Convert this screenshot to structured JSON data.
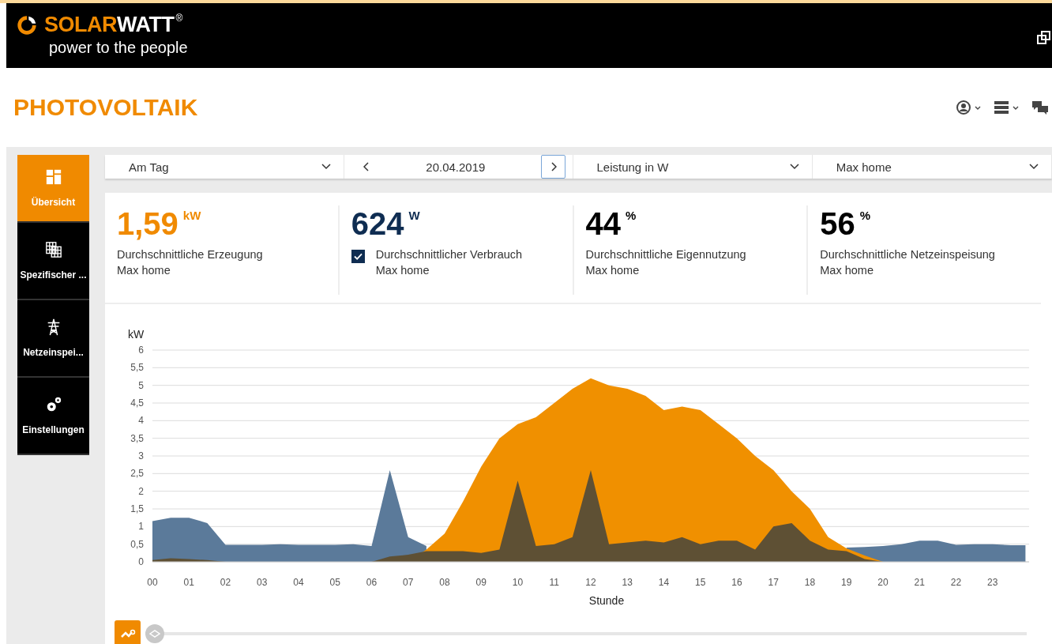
{
  "header": {
    "brand_first": "SOLAR",
    "brand_second": "WATT",
    "registered": "®",
    "tagline": "power to the people"
  },
  "page_title": "PHOTOVOLTAIK",
  "sidebar": {
    "items": [
      {
        "label": "Übersicht",
        "selected": true
      },
      {
        "label": "Spezifischer ...",
        "selected": false
      },
      {
        "label": "Netzeinspei...",
        "selected": false
      },
      {
        "label": "Einstellungen",
        "selected": false
      }
    ]
  },
  "filters": {
    "period": "Am Tag",
    "date": "20.04.2019",
    "unit": "Leistung in W",
    "system": "Max home"
  },
  "stats": [
    {
      "value": "1,59",
      "unit": "kW",
      "label": "Durchschnittliche Erzeugung",
      "sub": "Max home",
      "color": "#f08a00"
    },
    {
      "value": "624",
      "unit": "W",
      "label": "Durchschnittlicher Verbrauch",
      "sub": "Max home",
      "color": "#0f2d52",
      "checked": true
    },
    {
      "value": "44",
      "unit": "%",
      "label": "Durchschnittliche Eigennutzung",
      "sub": "Max home",
      "color": "#000000"
    },
    {
      "value": "56",
      "unit": "%",
      "label": "Durchschnittliche Netzeinspeisung",
      "sub": "Max home",
      "color": "#000000"
    }
  ],
  "chart": {
    "chart_data": {
      "type": "area",
      "grid": true,
      "ylabel": "kW",
      "xlabel": "Stunde",
      "xlim": [
        0,
        24
      ],
      "ylim": [
        0,
        6
      ],
      "x": [
        0,
        0.5,
        1,
        1.5,
        2,
        2.5,
        3,
        3.5,
        4,
        4.5,
        5,
        5.5,
        6,
        6.5,
        7,
        7.5,
        8,
        8.5,
        9,
        9.5,
        10,
        10.5,
        11,
        11.5,
        12,
        12.5,
        13,
        13.5,
        14,
        14.5,
        15,
        15.5,
        16,
        16.5,
        17,
        17.5,
        18,
        18.5,
        19,
        19.5,
        20,
        20.5,
        21,
        21.5,
        22,
        22.5,
        23,
        23.5,
        23.9
      ],
      "xticks": [
        {
          "value": 0,
          "label": "00"
        },
        {
          "value": 1,
          "label": "01"
        },
        {
          "value": 2,
          "label": "02"
        },
        {
          "value": 3,
          "label": "03"
        },
        {
          "value": 4,
          "label": "04"
        },
        {
          "value": 5,
          "label": "05"
        },
        {
          "value": 6,
          "label": "06"
        },
        {
          "value": 7,
          "label": "07"
        },
        {
          "value": 8,
          "label": "08"
        },
        {
          "value": 9,
          "label": "09"
        },
        {
          "value": 10,
          "label": "10"
        },
        {
          "value": 11,
          "label": "11"
        },
        {
          "value": 12,
          "label": "12"
        },
        {
          "value": 13,
          "label": "13"
        },
        {
          "value": 14,
          "label": "14"
        },
        {
          "value": 15,
          "label": "15"
        },
        {
          "value": 16,
          "label": "16"
        },
        {
          "value": 17,
          "label": "17"
        },
        {
          "value": 18,
          "label": "18"
        },
        {
          "value": 19,
          "label": "19"
        },
        {
          "value": 20,
          "label": "20"
        },
        {
          "value": 21,
          "label": "21"
        },
        {
          "value": 22,
          "label": "22"
        },
        {
          "value": 23,
          "label": "23"
        }
      ],
      "yticks": [
        0,
        {
          "value": 0.5,
          "label": "0,5"
        },
        1,
        {
          "value": 1.5,
          "label": "1,5"
        },
        2,
        {
          "value": 2.5,
          "label": "2,5"
        },
        3,
        {
          "value": 3.5,
          "label": "3,5"
        },
        4,
        {
          "value": 4.5,
          "label": "4,5"
        },
        5,
        {
          "value": 5.5,
          "label": "5,5"
        },
        6
      ],
      "series": [
        {
          "color": "#5b7a9a",
          "values": [
            1.15,
            1.25,
            1.25,
            1.1,
            0.48,
            0.48,
            0.48,
            0.5,
            0.48,
            0.48,
            0.48,
            0.5,
            0.45,
            2.6,
            0.7,
            0.45,
            null,
            null,
            null,
            null,
            null,
            null,
            null,
            null,
            null,
            null,
            null,
            null,
            null,
            null,
            null,
            null,
            null,
            null,
            null,
            null,
            null,
            null,
            0.4,
            0.42,
            0.45,
            0.5,
            0.6,
            0.6,
            0.48,
            0.5,
            0.5,
            0.47,
            0.47
          ]
        },
        {
          "color": "#f09000",
          "values": [
            0,
            0,
            0,
            0,
            0,
            0,
            0,
            0,
            0,
            0,
            0,
            0,
            0,
            0,
            0,
            0.35,
            0.8,
            1.7,
            2.7,
            3.5,
            3.9,
            4.1,
            4.5,
            4.9,
            5.2,
            5.0,
            4.9,
            4.7,
            4.3,
            4.4,
            4.3,
            3.9,
            3.5,
            3.0,
            2.6,
            2.0,
            1.5,
            0.7,
            0.38,
            0.18,
            0,
            0,
            0,
            0,
            0,
            0,
            0,
            0,
            0
          ]
        },
        {
          "color": "#5e5034",
          "values": [
            0.05,
            0.1,
            0.08,
            0.05,
            0,
            0,
            0,
            0,
            0,
            0,
            0,
            0,
            0,
            0.15,
            0.2,
            0.3,
            0.3,
            0.3,
            0.25,
            0.35,
            2.3,
            0.45,
            0.5,
            0.7,
            2.6,
            0.5,
            0.55,
            0.6,
            0.55,
            0.7,
            0.5,
            0.6,
            0.6,
            0.35,
            1.0,
            1.1,
            0.6,
            0.35,
            0.3,
            0.08,
            0,
            0,
            0,
            0,
            0,
            0,
            0,
            0,
            0
          ]
        }
      ]
    }
  }
}
